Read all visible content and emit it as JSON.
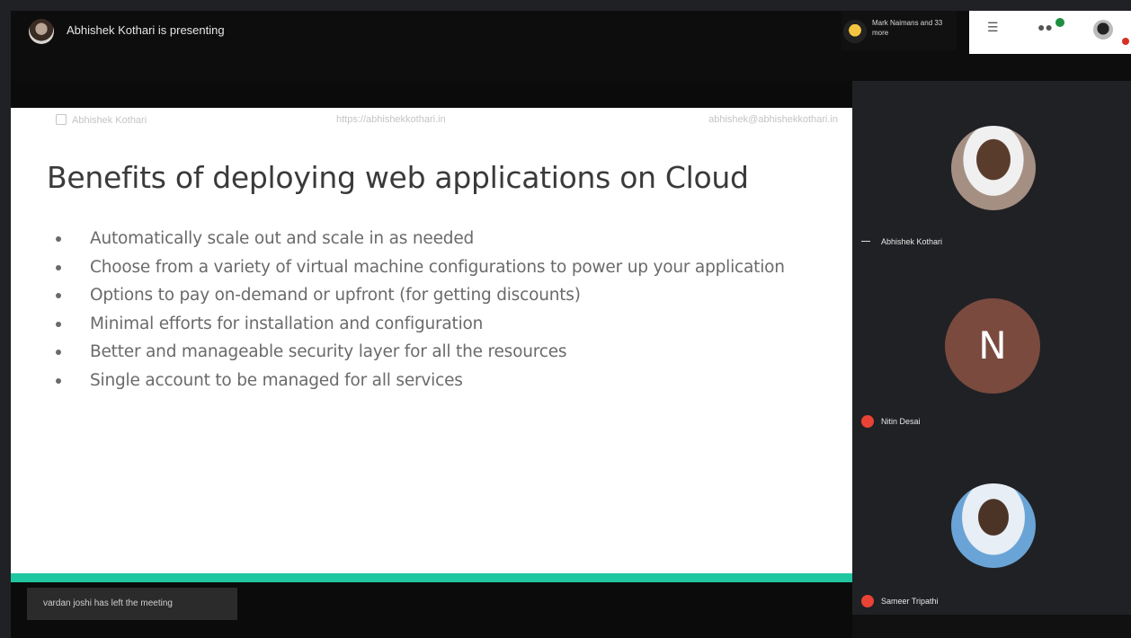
{
  "topbar": {
    "presenter_text": "Abhishek Kothari is presenting",
    "people_tile_text": "Mark Naimans and 33 more"
  },
  "slide": {
    "header_left": "Abhishek Kothari",
    "header_mid": "https://abhishekkothari.in",
    "header_right": "abhishek@abhishekkothari.in",
    "title": "Benefits of deploying web applications on Cloud",
    "bullets": [
      "Automatically scale out and scale in as needed",
      "Choose from a variety of virtual machine configurations to power up your application",
      "Options to pay on-demand or upfront (for getting discounts)",
      "Minimal efforts for installation and configuration",
      "Better and manageable security layer for all the resources",
      "Single account to be managed for all services"
    ]
  },
  "toast": {
    "text": "vardan joshi has left the meeting"
  },
  "participants": [
    {
      "name": "Abhishek Kothari"
    },
    {
      "initial": "N",
      "name": "Nitin Desai"
    },
    {
      "name": "Sameer Tripathi"
    }
  ],
  "colors": {
    "accent_bar": "#1fc7a0",
    "mic_off": "#ea4335",
    "slide_bg": "#ffffff",
    "panel_bg": "#202124"
  }
}
